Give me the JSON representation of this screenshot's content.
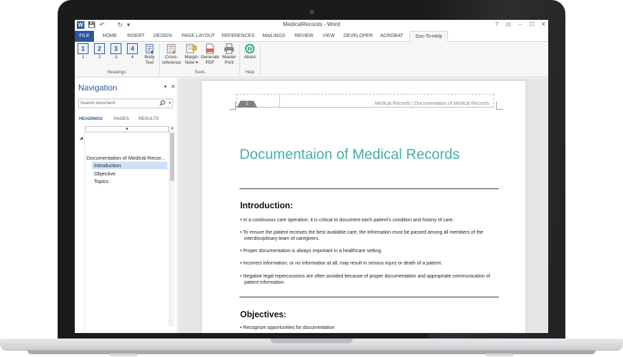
{
  "window": {
    "title": "MedicalRecords - Word",
    "app_icon_letter": "W",
    "qat": {
      "save_glyph": "💾",
      "undo_glyph": "↶",
      "redo_glyph": "↻",
      "customize_glyph": "▾"
    },
    "controls": {
      "help": "?",
      "options": "⊡",
      "minimize": "–",
      "maximize": "☐",
      "close": "✕"
    }
  },
  "tabs": [
    {
      "label": "FILE"
    },
    {
      "label": "HOME"
    },
    {
      "label": "INSERT"
    },
    {
      "label": "DESIGN"
    },
    {
      "label": "PAGE LAYOUT"
    },
    {
      "label": "REFERENCES"
    },
    {
      "label": "MAILINGS"
    },
    {
      "label": "REVIEW"
    },
    {
      "label": "VIEW"
    },
    {
      "label": "DEVELOPER"
    },
    {
      "label": "ACROBAT"
    },
    {
      "label": "Doc-To-Help"
    }
  ],
  "ribbon": {
    "headings": {
      "buttons": [
        {
          "icon_text": "1",
          "label": "1"
        },
        {
          "icon_text": "2",
          "label": "2"
        },
        {
          "icon_text": "3",
          "label": "3"
        },
        {
          "icon_text": "4",
          "label": "4"
        }
      ],
      "body_text": {
        "line1": "Body",
        "line2": "Text",
        "icon": "paragraph-icon"
      },
      "group_label": "Headings"
    },
    "tools": {
      "cross_reference": {
        "line1": "Cross-",
        "line2": "reference"
      },
      "margin_note": {
        "line1": "Margin",
        "line2": "Note ▾"
      },
      "generate_pdf": {
        "line1": "Generate",
        "line2": "PDF"
      },
      "master_print": {
        "line1": "Master",
        "line2": "Print"
      },
      "group_label": "Tools"
    },
    "help": {
      "about": {
        "line1": "About"
      },
      "group_label": "Help"
    }
  },
  "navigation": {
    "title": "Navigation",
    "dropdown_glyph": "▾",
    "close_glyph": "✕",
    "search_placeholder": "Search document",
    "tabs": [
      {
        "label": "HEADINGS"
      },
      {
        "label": "PAGES"
      },
      {
        "label": "RESULTS"
      }
    ],
    "collapse_glyph": "▲",
    "tree": [
      {
        "label": "Documentation of Medical Recor..."
      },
      {
        "label": "Introduction"
      },
      {
        "label": "Objective"
      },
      {
        "label": "Topics"
      }
    ]
  },
  "document": {
    "header_page": "1",
    "header_text": "Medical Records | Documentation of Medical Records",
    "title": "Documentaion of Medical Records",
    "sections": [
      {
        "heading": "Introduction:",
        "bullets": [
          "• In a continuous care operation, it is critical to document each patient's condition and history of care.",
          "• To ensure the patient receives the best available care, the information must be passed among all members of the interdisciplinary team of caregivers.",
          "• Proper documentation is always important in a healthcare setting.",
          "• Incorrect information, or no information at all, may result in serious injury or death of a patient.",
          "• Negative legal repercussions are often avoided because of proper documentation and appropriate communication of patient information."
        ]
      },
      {
        "heading": "Objectives:",
        "bullets": [
          "• Recognize opportunities for documentation"
        ]
      }
    ]
  },
  "colors": {
    "word_blue": "#2b579a",
    "title_teal": "#48b0a1",
    "selected_row": "#cde0f7"
  }
}
